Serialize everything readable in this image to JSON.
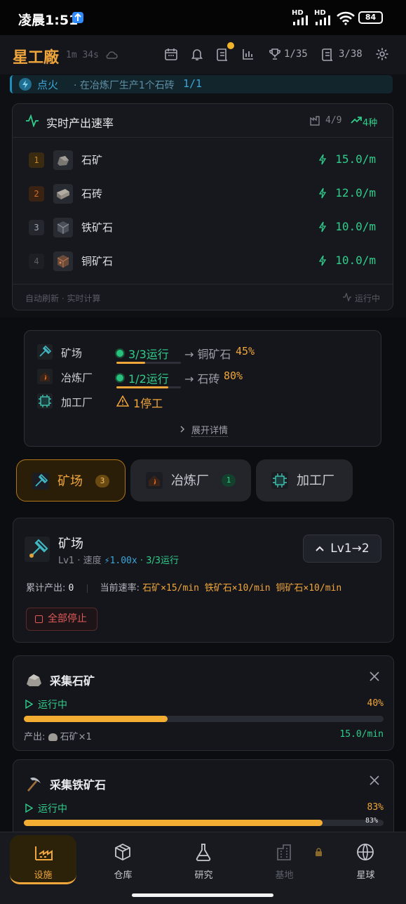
{
  "status": {
    "time": "凌晨1:51",
    "battery": "84",
    "sig1": "HD",
    "sig2": "HD"
  },
  "header": {
    "logo": "星工廠",
    "elapsed": "1m 34s",
    "trophies": "1/35",
    "tasks": "3/38"
  },
  "quest": {
    "title": "点火",
    "desc": "· 在冶炼厂生产1个石砖",
    "progress": "1/1"
  },
  "rate_panel": {
    "title": "实时产出速率",
    "stat_a": "4/9",
    "stat_b": "4种",
    "rows": [
      {
        "rank": "1",
        "name": "石矿",
        "value": "15.0/m"
      },
      {
        "rank": "2",
        "name": "石砖",
        "value": "12.0/m"
      },
      {
        "rank": "3",
        "name": "铁矿石",
        "value": "10.0/m"
      },
      {
        "rank": "4",
        "name": "铜矿石",
        "value": "10.0/m"
      }
    ],
    "footer_left": "自动刷新 · 实时计算",
    "footer_right": "运行中"
  },
  "summary": {
    "rows": [
      {
        "name": "矿场",
        "status": "3/3运行",
        "target": "→ 铜矿石",
        "pct": "45%",
        "progress": 0.45
      },
      {
        "name": "冶炼厂",
        "status": "1/2运行",
        "target": "→ 石砖",
        "pct": "80%",
        "progress": 0.8
      },
      {
        "name": "加工厂",
        "status": "1停工"
      }
    ],
    "expand": "展开详情"
  },
  "tabs": [
    {
      "label": "矿场",
      "badge": "3"
    },
    {
      "label": "冶炼厂",
      "badge": "1"
    },
    {
      "label": "加工厂"
    }
  ],
  "facility": {
    "name": "矿场",
    "meta_level": "Lv1 · 速度",
    "meta_speed": "⚡1.00x",
    "meta_running": "· 3/3运行",
    "upgrade": "Lv1→2",
    "total_label": "累计产出:",
    "total_value": "0",
    "rate_label": "当前速率:",
    "rates": "石矿×15/min 铁矿石×10/min 铜矿石×10/min",
    "stop_all": "全部停止"
  },
  "jobs": [
    {
      "name": "采集石矿",
      "status": "运行中",
      "pct": "40%",
      "progress": 0.4,
      "output_label": "产出:",
      "output": "石矿×1",
      "rate": "15.0/min"
    },
    {
      "name": "采集铁矿石",
      "status": "运行中",
      "pct": "83%",
      "bar_text": "83%",
      "progress": 0.83
    }
  ],
  "nav": [
    {
      "label": "设施"
    },
    {
      "label": "仓库"
    },
    {
      "label": "研究"
    },
    {
      "label": "基地"
    },
    {
      "label": "星球"
    }
  ],
  "colors": {
    "accent": "#f0a63b",
    "green": "#2fcd8b",
    "danger": "#e05a5a",
    "info": "#3aa6d9"
  }
}
